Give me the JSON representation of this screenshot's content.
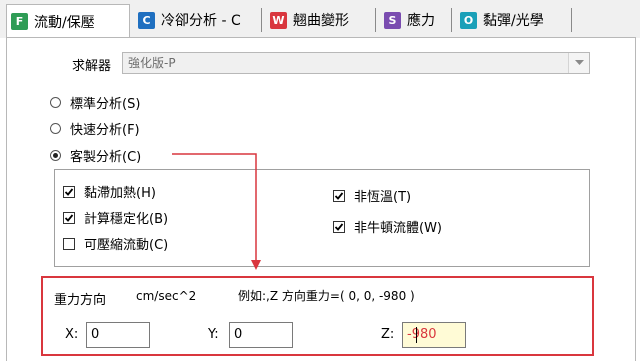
{
  "tabs": [
    {
      "badge": "F",
      "label": "流動/保壓",
      "color": "#2e9c55",
      "active": true
    },
    {
      "badge": "C",
      "label": "冷卻分析 - C",
      "color": "#1f6fc0",
      "active": false
    },
    {
      "badge": "W",
      "label": "翹曲變形",
      "color": "#d9363e",
      "active": false
    },
    {
      "badge": "S",
      "label": "應力",
      "color": "#7a4cb0",
      "active": false
    },
    {
      "badge": "O",
      "label": "黏彈/光學",
      "color": "#1aa0b8",
      "active": false
    }
  ],
  "solver": {
    "label": "求解器",
    "value": "強化版-P"
  },
  "analysis_options": [
    {
      "label": "標準分析(S)",
      "selected": false
    },
    {
      "label": "快速分析(F)",
      "selected": false
    },
    {
      "label": "客製分析(C)",
      "selected": true
    }
  ],
  "custom_options": [
    {
      "label": "黏滯加熱(H)",
      "checked": true
    },
    {
      "label": "計算穩定化(B)",
      "checked": true
    },
    {
      "label": "可壓縮流動(C)",
      "checked": false
    },
    {
      "label": "非恆溫(T)",
      "checked": true
    },
    {
      "label": "非牛頓流體(W)",
      "checked": true
    }
  ],
  "gravity": {
    "label": "重力方向",
    "unit": "cm/sec^2",
    "example": "例如:,Z 方向重力=( 0, 0, -980 )",
    "x_label": "X:",
    "x_value": "0",
    "y_label": "Y:",
    "y_value": "0",
    "z_label": "Z:",
    "z_value": "-980"
  },
  "colors": {
    "annotation_red": "#d9363e"
  }
}
